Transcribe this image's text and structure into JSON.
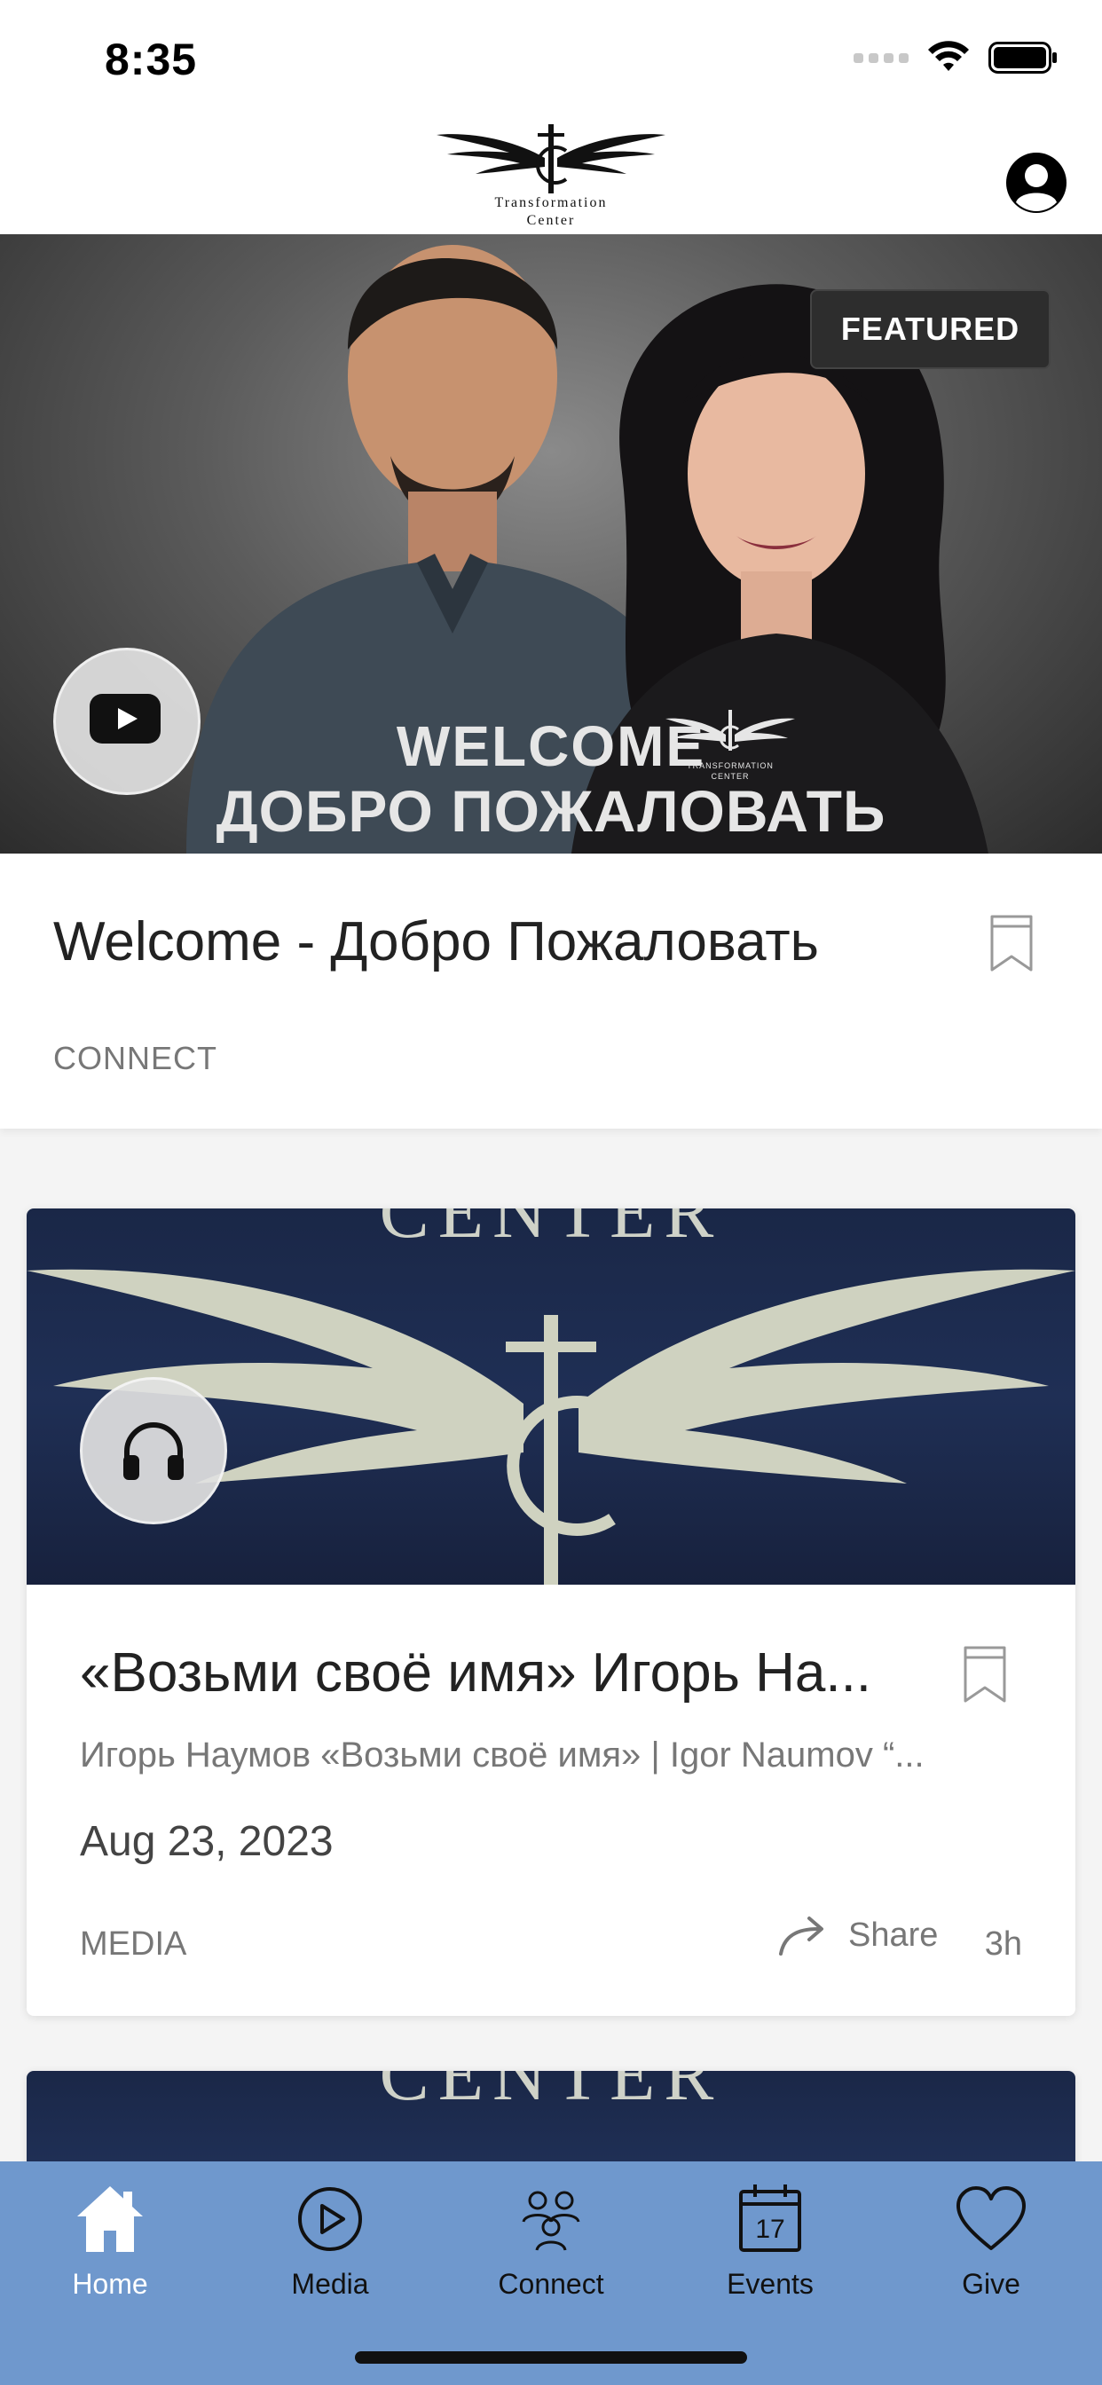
{
  "status_bar": {
    "time": "8:35"
  },
  "header": {
    "logo_text_line1": "Transformation",
    "logo_text_line2": "Center"
  },
  "featured": {
    "badge": "FEATURED",
    "image_line1": "WELCOME",
    "image_line2": "ДОБРО ПОЖАЛОВАТЬ",
    "image_logo_line1": "TRANSFORMATION",
    "image_logo_line2": "CENTER",
    "title": "Welcome - Добро Пожаловать",
    "category": "CONNECT",
    "media_icon": "youtube-play-icon"
  },
  "cards": [
    {
      "image_text": "CENTER",
      "title": "«Возьми своё имя» Игорь На...",
      "subtitle": "Игорь Наумов «Возьми своё имя» | Igor Naumov “...",
      "date": "Aug 23, 2023",
      "category": "MEDIA",
      "share_label": "Share",
      "age": "3h",
      "media_icon": "headphones-icon"
    },
    {
      "image_text": "CENTER"
    }
  ],
  "tabbar": {
    "items": [
      {
        "label": "Home",
        "icon": "home-icon",
        "active": true
      },
      {
        "label": "Media",
        "icon": "play-circle-icon",
        "active": false
      },
      {
        "label": "Connect",
        "icon": "people-icon",
        "active": false
      },
      {
        "label": "Events",
        "icon": "calendar-icon",
        "active": false,
        "calendar_day": "17"
      },
      {
        "label": "Give",
        "icon": "heart-icon",
        "active": false
      }
    ]
  },
  "colors": {
    "tabbar_bg": "#6f98cd",
    "active_tab": "#ffffff",
    "card_image_bg": "#1f2f55"
  }
}
